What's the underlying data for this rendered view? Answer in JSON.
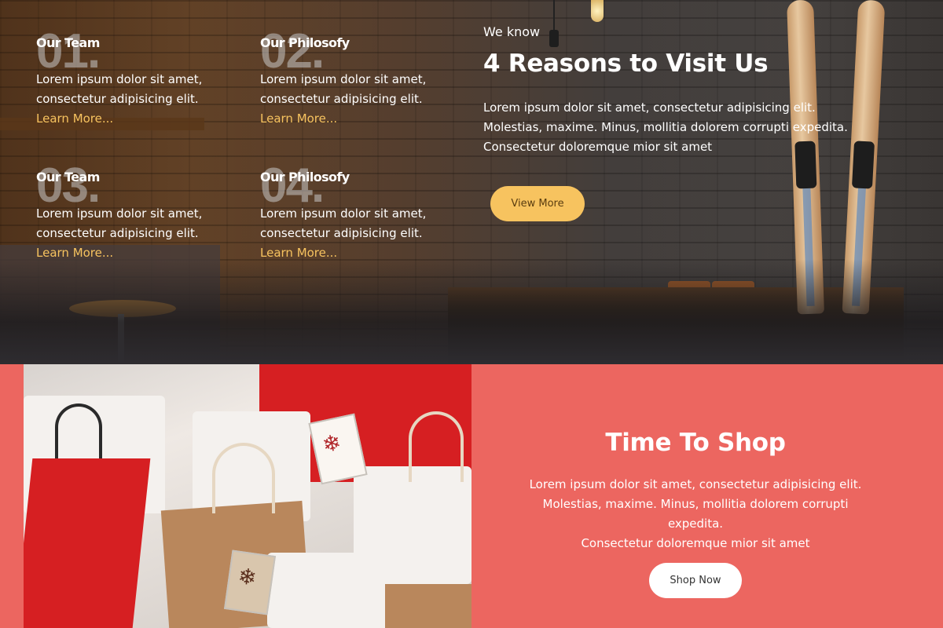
{
  "reasons": {
    "features": [
      {
        "number": "01.",
        "title": "Our Team",
        "desc_lines": [
          "Lorem ipsum dolor sit amet,",
          "consectetur adipisicing elit."
        ],
        "link": "Learn More..."
      },
      {
        "number": "02.",
        "title": "Our Philosofy",
        "desc_lines": [
          "Lorem ipsum dolor sit amet,",
          "consectetur adipisicing elit."
        ],
        "link": "Learn More..."
      },
      {
        "number": "03.",
        "title": "Our Team",
        "desc_lines": [
          "Lorem ipsum dolor sit amet,",
          "consectetur adipisicing elit."
        ],
        "link": "Learn More..."
      },
      {
        "number": "04.",
        "title": "Our Philosofy",
        "desc_lines": [
          "Lorem ipsum dolor sit amet,",
          "consectetur adipisicing elit."
        ],
        "link": "Learn More..."
      }
    ],
    "eyebrow": "We know",
    "headline": "4 Reasons to Visit Us",
    "body": "Lorem ipsum dolor sit amet, consectetur adipisicing elit. Molestias, maxime. Minus, mollitia dolorem corrupti expedita. Consectetur doloremque mior sit amet",
    "button_label": "View More"
  },
  "shop": {
    "title": "Time To Shop",
    "body_lines": [
      "Lorem ipsum dolor sit amet, consectetur adipisicing elit.",
      "Molestias, maxime. Minus, mollitia dolorem corrupti expedita.",
      "Consectetur doloremque mior sit amet"
    ],
    "button_label": "Shop Now"
  },
  "colors": {
    "accent_yellow": "#f7c35f",
    "shop_background": "#ec6660",
    "text_white": "#ffffff"
  }
}
